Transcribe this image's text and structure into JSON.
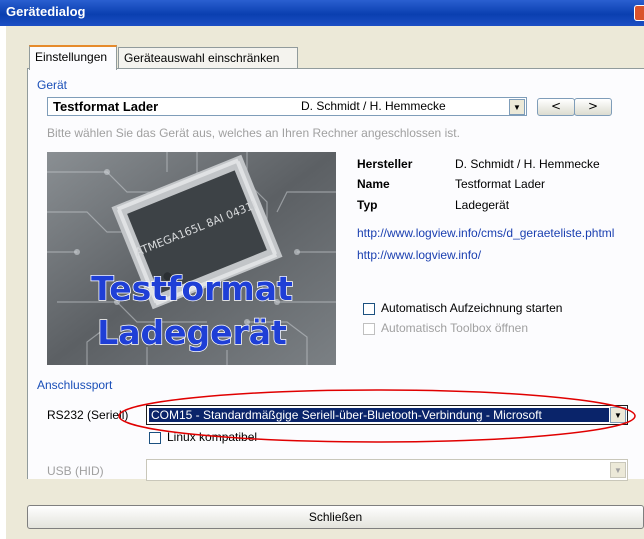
{
  "window": {
    "title": "Gerätedialog"
  },
  "tabs": [
    {
      "label": "Einstellungen"
    },
    {
      "label": "Geräteauswahl einschränken"
    }
  ],
  "device_group": {
    "label": "Gerät",
    "device_name": "Testformat Lader",
    "manufacturer_select": "D. Schmidt / H. Hemmecke",
    "prev_label": "<",
    "next_label": ">",
    "hint": "Bitte wählen Sie das Gerät aus, welches an Ihren Rechner angeschlossen ist.",
    "image_text_line1": "Testformat",
    "image_text_line2": "Ladegerät",
    "chip_text": "ATMEGA165L 8AI 0431I",
    "info": {
      "hersteller_label": "Hersteller",
      "hersteller_value": "D. Schmidt / H. Hemmecke",
      "name_label": "Name",
      "name_value": "Testformat Lader",
      "typ_label": "Typ",
      "typ_value": "Ladegerät"
    },
    "link1": "http://www.logview.info/cms/d_geraeteliste.phtml",
    "link2": "http://www.logview.info/",
    "auto_record": {
      "label": "Automatisch Aufzeichnung starten",
      "checked": false
    },
    "auto_toolbox": {
      "label": "Automatisch Toolbox öffnen",
      "checked": false
    }
  },
  "port_group": {
    "label": "Anschlussport",
    "rs232_label": "RS232 (Seriell)",
    "rs232_value": "COM15  -  Standardmäßgige Seriell-über-Bluetooth-Verbindung  -  Microsoft",
    "linux_label": "Linux kompatibel",
    "usb_label": "USB (HID)",
    "usb_value": ""
  },
  "close_label": "Schließen",
  "colors": {
    "titlebar": "#0a3fb0",
    "group_label": "#1a4fb8",
    "link": "#1a3fb0",
    "selection": "#0a246a",
    "highlight_ellipse": "#e00000"
  }
}
